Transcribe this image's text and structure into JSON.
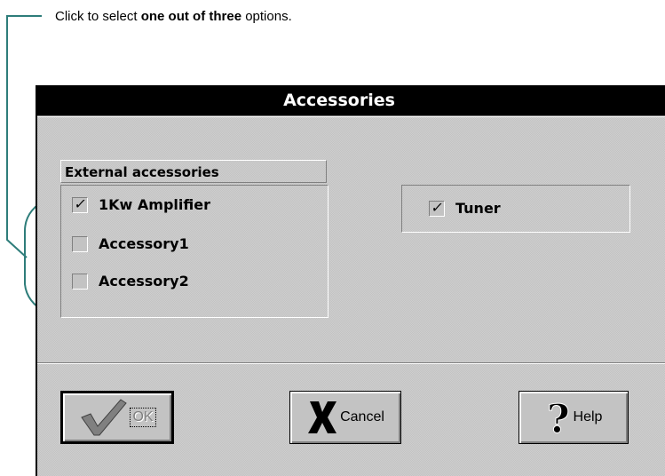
{
  "annotation": {
    "prefix": "Click to select ",
    "bold": "one out of three",
    "suffix": " options."
  },
  "dialog": {
    "title": "Accessories",
    "group": {
      "title": "External accessories",
      "items": [
        {
          "label": "1Kw Amplifier",
          "checked": true
        },
        {
          "label": "Accessory1",
          "checked": false
        },
        {
          "label": "Accessory2",
          "checked": false
        }
      ]
    },
    "tuner": {
      "label": "Tuner",
      "checked": true
    },
    "buttons": {
      "ok": "OK",
      "cancel": "Cancel",
      "help": "Help"
    },
    "check_glyph": "✓"
  },
  "colors": {
    "face": "#c3c3c3",
    "shadow": "#808080",
    "highlight": "#ffffff",
    "callout": "#2e7d7a"
  }
}
